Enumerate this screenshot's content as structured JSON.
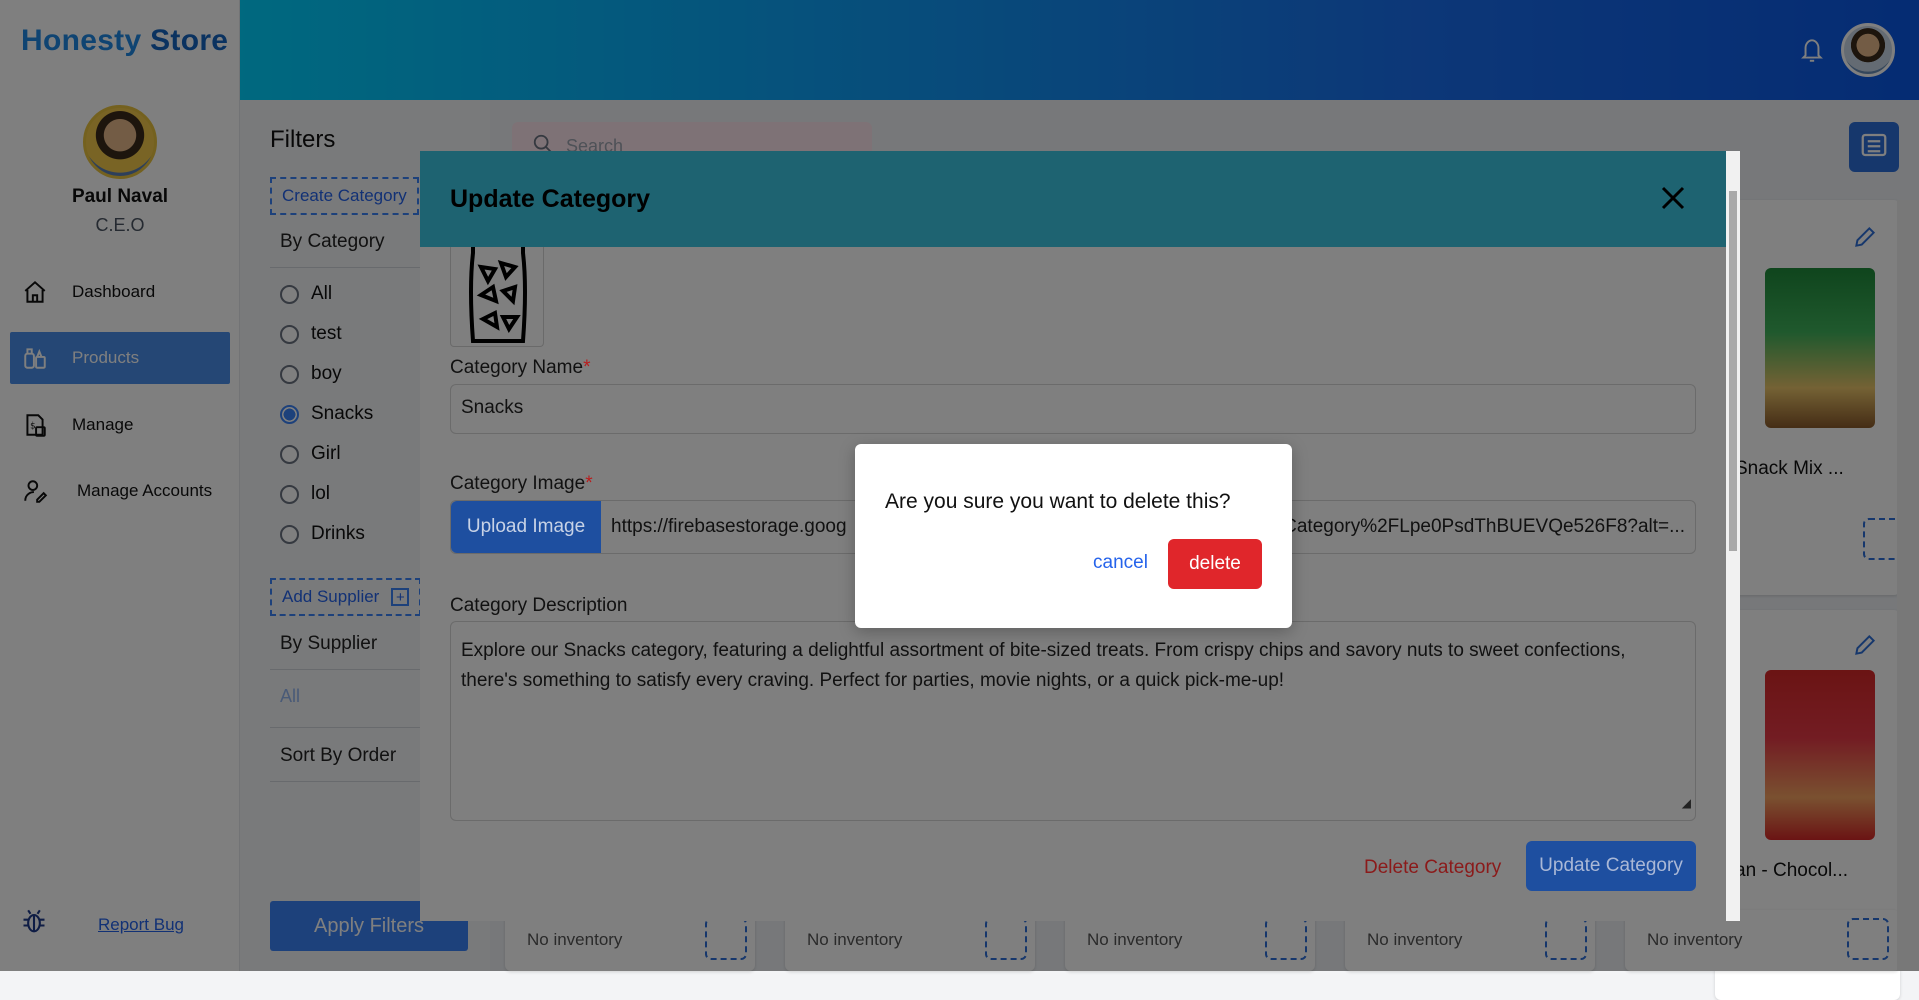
{
  "app": {
    "brand_part1": "Honesty",
    "brand_part2": "Store"
  },
  "user": {
    "name": "Paul Naval",
    "role": "C.E.O"
  },
  "sidebar": {
    "items": [
      {
        "label": "Dashboard",
        "icon": "home-icon"
      },
      {
        "label": "Products",
        "icon": "products-icon",
        "active": true
      },
      {
        "label": "Manage",
        "icon": "manage-icon"
      },
      {
        "label": "Manage Accounts",
        "icon": "accounts-icon"
      }
    ],
    "report_bug": "Report Bug"
  },
  "filters": {
    "title": "Filters",
    "create_category": "Create Category",
    "by_category": "By Category",
    "categories": [
      "All",
      "test",
      "boy",
      "Snacks",
      "Girl",
      "lol",
      "Drinks"
    ],
    "selected_category": "Snacks",
    "add_supplier": "Add Supplier",
    "by_supplier": "By Supplier",
    "supplier_all": "All",
    "sort_by_order": "Sort By Order",
    "apply_filters": "Apply Filters"
  },
  "main": {
    "search_placeholder": "Search",
    "cards": [
      {
        "title": "Snack Mix ..."
      },
      {
        "title": "an - Chocol..."
      }
    ],
    "inventory_labels": [
      "No inventory",
      "No inventory",
      "No inventory",
      "No inventory",
      "No inventory"
    ]
  },
  "update_modal": {
    "title": "Update Category",
    "name_label": "Category Name",
    "name_value": "Snacks",
    "image_label": "Category Image",
    "upload_button": "Upload Image",
    "image_url_start": "https://firebasestorage.goog",
    "image_url_end": "Category%2FLpe0PsdThBUEVQe526F8?alt=...",
    "description_label": "Category Description",
    "description_value": "Explore our Snacks category, featuring a delightful assortment of bite-sized treats. From crispy chips and savory nuts to sweet confections, there's something to satisfy every craving. Perfect for parties, movie nights, or a quick pick-me-up!",
    "delete_button": "Delete Category",
    "update_button": "Update Category"
  },
  "confirm_dialog": {
    "question": "Are you sure you want to delete this?",
    "cancel": "cancel",
    "delete": "delete"
  },
  "colors": {
    "brand_blue": "#1e88e5",
    "active_nav": "#4a8fea",
    "modal_header": "#1e6371",
    "delete_red": "#e0262b"
  }
}
